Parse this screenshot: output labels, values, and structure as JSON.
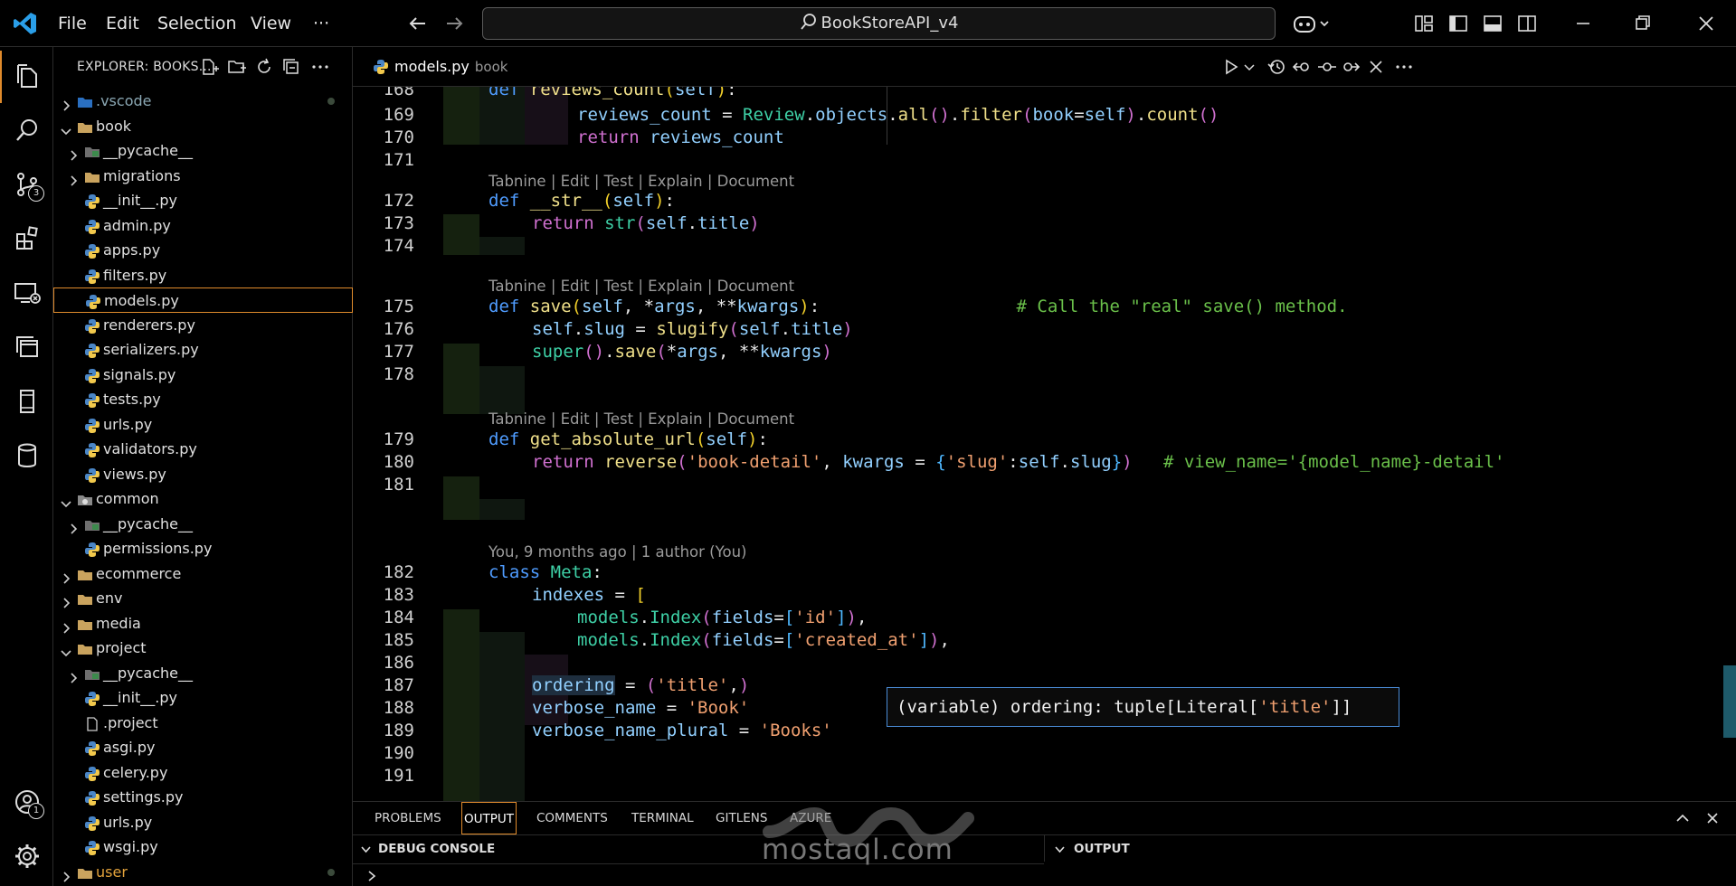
{
  "titlebar": {
    "menu": [
      "File",
      "Edit",
      "Selection",
      "View",
      "···"
    ],
    "search_text": "BookStoreAPI_v4"
  },
  "activitybar": {
    "source_control_badge": "3",
    "accounts_badge": "1"
  },
  "sidebar": {
    "title": "EXPLORER: BOOKS...",
    "items": [
      {
        "label": ".vscode"
      },
      {
        "label": "book"
      },
      {
        "label": "__pycache__"
      },
      {
        "label": "migrations"
      },
      {
        "label": "__init__.py"
      },
      {
        "label": "admin.py"
      },
      {
        "label": "apps.py"
      },
      {
        "label": "filters.py"
      },
      {
        "label": "models.py"
      },
      {
        "label": "renderers.py"
      },
      {
        "label": "serializers.py"
      },
      {
        "label": "signals.py"
      },
      {
        "label": "tests.py"
      },
      {
        "label": "urls.py"
      },
      {
        "label": "validators.py"
      },
      {
        "label": "views.py"
      },
      {
        "label": "common"
      },
      {
        "label": "__pycache__"
      },
      {
        "label": "permissions.py"
      },
      {
        "label": "ecommerce"
      },
      {
        "label": "env"
      },
      {
        "label": "media"
      },
      {
        "label": "project"
      },
      {
        "label": "__pycache__"
      },
      {
        "label": "__init__.py"
      },
      {
        "label": ".project"
      },
      {
        "label": "asgi.py"
      },
      {
        "label": "celery.py"
      },
      {
        "label": "settings.py"
      },
      {
        "label": "urls.py"
      },
      {
        "label": "wsgi.py"
      },
      {
        "label": "user"
      }
    ]
  },
  "editor": {
    "tab_label": "models.py",
    "tab_desc": "book",
    "codelens_tabnine": "Tabnine | Edit | Test | Explain | Document",
    "codelens_blame": "You, 9 months ago | 1 author (You)",
    "line_numbers": [
      "168",
      "169",
      "170",
      "171",
      "172",
      "173",
      "174",
      "175",
      "176",
      "177",
      "178",
      "179",
      "180",
      "181",
      "182",
      "183",
      "184",
      "185",
      "186",
      "187",
      "188",
      "189",
      "190",
      "191"
    ],
    "hover": {
      "prefix": "(variable) ordering: tuple[Literal[",
      "literal": "'title'",
      "suffix": "]]"
    }
  },
  "panel": {
    "tabs": [
      "PROBLEMS",
      "OUTPUT",
      "COMMENTS",
      "TERMINAL",
      "GITLENS",
      "AZURE"
    ],
    "debug_console": "DEBUG CONSOLE",
    "output": "OUTPUT"
  },
  "watermark": {
    "text": "mostaql.com"
  },
  "colors": {
    "accent": "#e08b2c",
    "keyword": "#4f9cff",
    "function": "#f0e08a",
    "string": "#f0a070",
    "comment": "#6ac04a"
  }
}
